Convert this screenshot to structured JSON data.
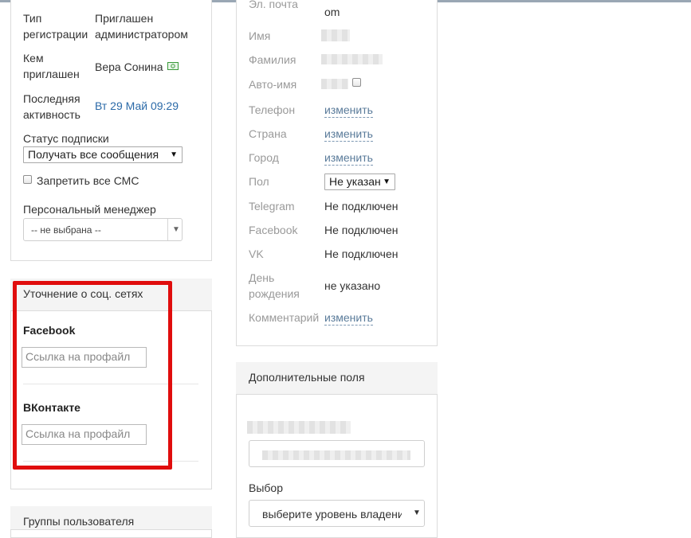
{
  "left_panel": {
    "reg_type_label": "Тип регистрации",
    "reg_type_value": "Приглашен администратором",
    "invited_by_label": "Кем приглашен",
    "invited_by_value": "Вера Сонина",
    "last_activity_label": "Последняя активность",
    "last_activity_value": "Вт 29 Май 09:29",
    "subscription_label": "Статус подписки",
    "subscription_value": "Получать все сообщения",
    "block_sms_label": "Запретить все СМС",
    "manager_label": "Персональный менеджер",
    "manager_value": "-- не выбрана --"
  },
  "social_panel": {
    "title": "Уточнение о соц. сетях",
    "facebook_label": "Facebook",
    "facebook_placeholder": "Ссылка на профайл",
    "vk_label": "ВКонтакте",
    "vk_placeholder": "Ссылка на профайл"
  },
  "groups_panel": {
    "title": "Группы пользователя"
  },
  "profile_panel": {
    "email_label": "Эл. почта",
    "email_value_tail": "om",
    "first_name_label": "Имя",
    "last_name_label": "Фамилия",
    "auto_name_label": "Авто-имя",
    "phone_label": "Телефон",
    "phone_link": "изменить",
    "country_label": "Страна",
    "country_link": "изменить",
    "city_label": "Город",
    "city_link": "изменить",
    "gender_label": "Пол",
    "gender_value": "Не указан",
    "telegram_label": "Telegram",
    "telegram_value": "Не подключен",
    "facebook_label": "Facebook",
    "facebook_value": "Не подключен",
    "vk_label": "VK",
    "vk_value": "Не подключен",
    "birthday_label": "День рождения",
    "birthday_value": "не указано",
    "comment_label": "Комментарий",
    "comment_link": "изменить"
  },
  "extra_panel": {
    "title": "Дополнительные поля",
    "choice_label": "Выбор",
    "choice_value": "выберите уровень владени"
  },
  "colors": {
    "highlight": "#e00d0d",
    "link": "#2b6aa8",
    "muted_label": "#9a9a9a"
  }
}
